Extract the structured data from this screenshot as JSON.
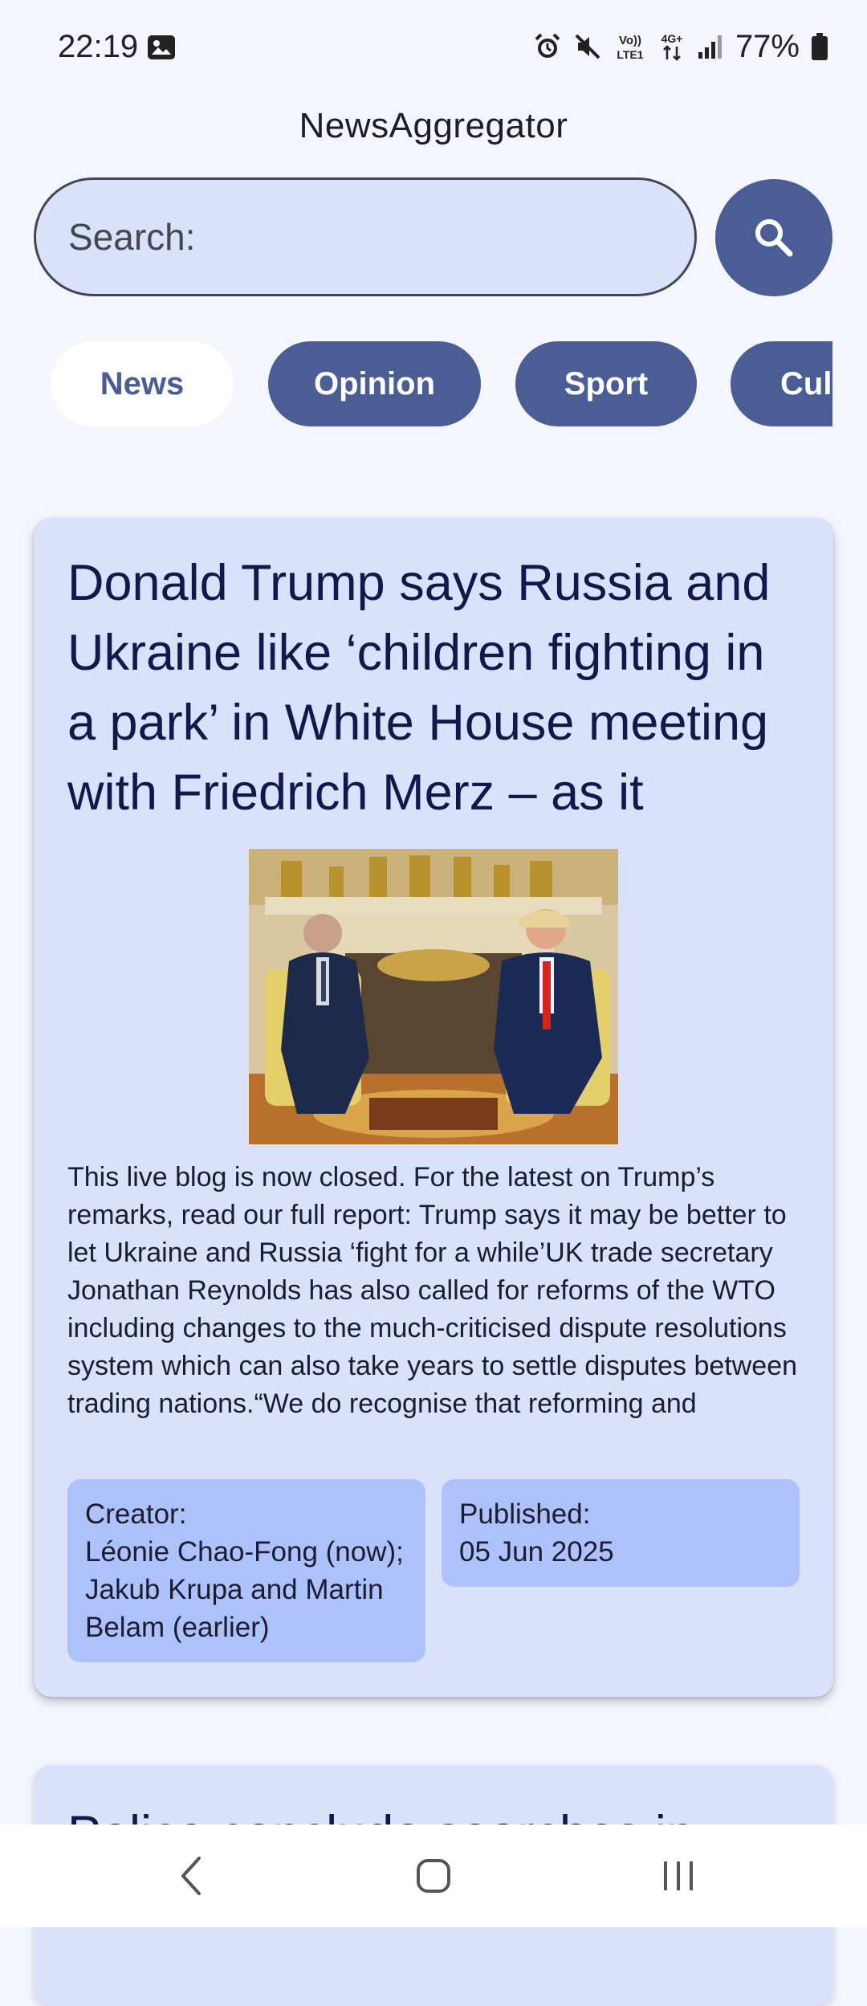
{
  "status_bar": {
    "time": "22:19",
    "network_label": "Vo) LTE1",
    "network_type": "4G+",
    "battery": "77%",
    "icons": [
      "image-icon",
      "alarm-icon",
      "mute-icon",
      "volte-icon",
      "data-arrows-icon",
      "signal-icon",
      "battery-icon"
    ]
  },
  "app": {
    "title": "NewsAggregator"
  },
  "search": {
    "placeholder": "Search:",
    "button_icon": "search-icon"
  },
  "categories": [
    {
      "label": "News",
      "active": true
    },
    {
      "label": "Opinion",
      "active": false
    },
    {
      "label": "Sport",
      "active": false
    },
    {
      "label": "Culture",
      "active": false
    }
  ],
  "articles": [
    {
      "headline": "Donald Trump says Russia and Ukraine like ‘children fighting in a park’ in White House meeting with Friedrich Merz – as it",
      "summary": "This live blog is now closed. For the latest on Trump’s remarks, read our full report: Trump says it may be better to let Ukraine and Russia ‘fight for a while’UK trade secretary Jonathan Reynolds has also called for reforms of the WTO including changes to the much-criticised dispute resolutions system which can also take years to settle disputes between trading nations.“We do recognise that reforming and",
      "creator_label": "Creator:",
      "creator": "Léonie Chao-Fong (now); Jakub Krupa and Martin Belam (earlier)",
      "published_label": "Published:",
      "published": "05 Jun 2025"
    },
    {
      "headline": "Police conclude searches in"
    }
  ],
  "colors": {
    "background": "#f4f5fd",
    "primary": "#4a5d94",
    "card": "#d9e1fb",
    "meta_box": "#adc1fa",
    "headline": "#11184a"
  },
  "nav_bar": {
    "back_icon": "back-icon",
    "home_icon": "home-icon",
    "recents_icon": "recent-apps-icon"
  }
}
